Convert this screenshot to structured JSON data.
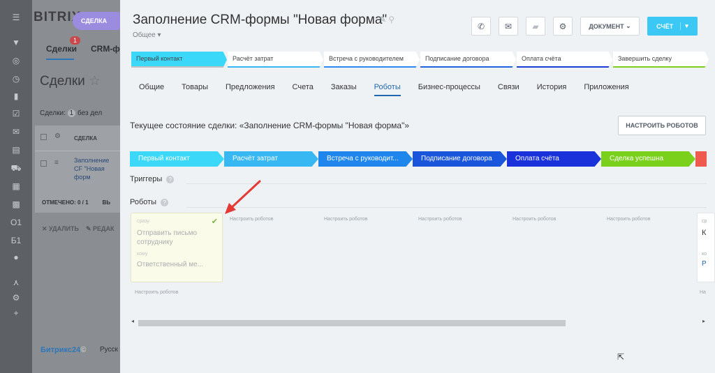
{
  "bg": {
    "brand": "BITRIX",
    "deal_pill": "СДЕЛКА",
    "tab_deals": "Сделки",
    "tab_crm": "CRM-ф",
    "badge": "1",
    "heading": "Сделки",
    "filter_text": "Сделки:",
    "filter_count": "1",
    "filter_rest": "без дел",
    "col_deal": "СДЕЛКА",
    "row_link": "Заполнение CF \"Новая форм",
    "marked": "ОТМЕЧЕНО: 0 / 1",
    "marked_b": "ВЬ",
    "delete": "✕ УДАЛИТЬ",
    "edit": "✎ РЕДАК",
    "b24": "Битрикс24",
    "lang": "Русск",
    "side_labels": [
      "О1",
      "Б1"
    ]
  },
  "header": {
    "title": "Заполнение CRM-формы \"Новая форма\"",
    "subtitle": "Общее",
    "doc_button": "ДОКУМЕНТ",
    "score_button": "СЧЁТ"
  },
  "top_stages": [
    "Первый контакт",
    "Расчёт затрат",
    "Встреча с руководителем",
    "Подписание договора",
    "Оплата счёта",
    "Завершить сделку"
  ],
  "top_stage_colors": [
    "#3bd8f9",
    "#39b6f2",
    "#2b8af1",
    "#1f63e0",
    "#1a3fd6",
    "#7bd01b"
  ],
  "tabs": [
    "Общие",
    "Товары",
    "Предложения",
    "Счета",
    "Заказы",
    "Роботы",
    "Бизнес-процессы",
    "Связи",
    "История",
    "Приложения"
  ],
  "state_text": "Текущее состояние сделки: «Заполнение CRM-формы \"Новая форма\"»",
  "setup_button": "НАСТРОИТЬ РОБОТОВ",
  "stages": [
    {
      "label": "Первый контакт",
      "color": "#3bd8f9"
    },
    {
      "label": "Расчёт затрат",
      "color": "#38b8f3"
    },
    {
      "label": "Встреча с руководит...",
      "color": "#1f86ec"
    },
    {
      "label": "Подписание договора",
      "color": "#1a56dc"
    },
    {
      "label": "Оплата счёта",
      "color": "#1932d9"
    },
    {
      "label": "Сделка успешна",
      "color": "#7bd01b"
    }
  ],
  "triggers_label": "Триггеры",
  "robots_label": "Роботы",
  "card": {
    "line1": "сразу",
    "title": "Отправить письмо сотруднику",
    "line3": "кому",
    "line4": "Ответственный ме..."
  },
  "configure": "Настроить роботов",
  "edge": {
    "a": "ср",
    "b": "К",
    "c": "ко",
    "d": "Р",
    "e": "На"
  }
}
